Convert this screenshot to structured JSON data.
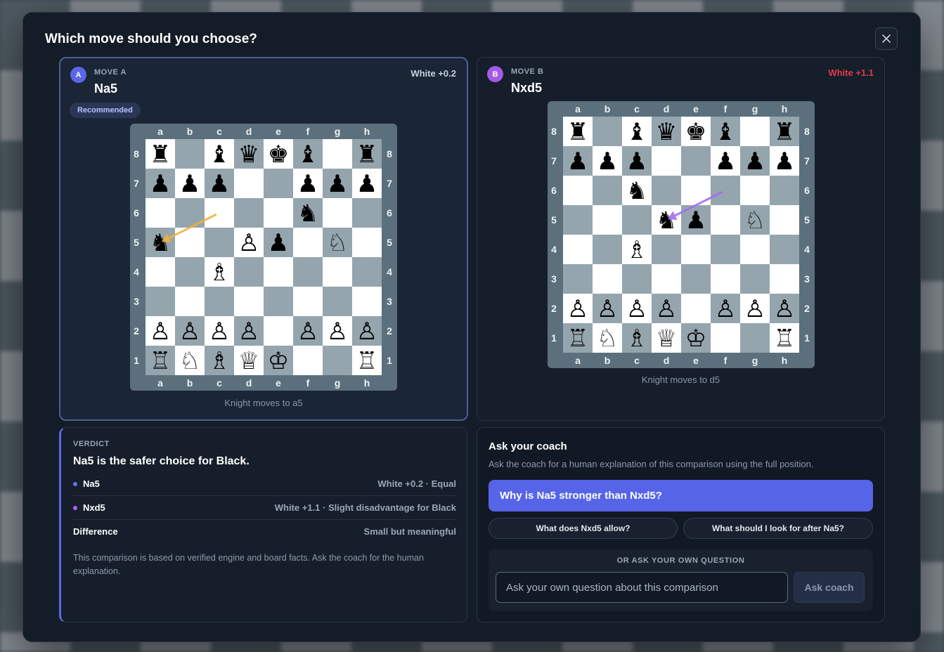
{
  "dialog": {
    "title": "Which move should you choose?",
    "close_icon": "close-icon"
  },
  "move_a": {
    "badge": "A",
    "label": "MOVE A",
    "san": "Na5",
    "eval": "White +0.2",
    "eval_color": "#c9d1db",
    "badge_color": "#5b67e6",
    "tag": "Recommended",
    "caption": "Knight moves to a5",
    "arrow_color": "#f0b23a",
    "arrow_from": "c6",
    "arrow_to": "a5",
    "position": [
      [
        "r",
        "",
        "b",
        "q",
        "k",
        "b",
        "",
        "r"
      ],
      [
        "p",
        "p",
        "p",
        "",
        "",
        "p",
        "p",
        "p"
      ],
      [
        "",
        "",
        "",
        "",
        "",
        "n",
        "",
        ""
      ],
      [
        "n",
        "",
        "",
        "P",
        "p",
        "",
        "N",
        ""
      ],
      [
        "",
        "",
        "B",
        "",
        "",
        "",
        "",
        ""
      ],
      [
        "",
        "",
        "",
        "",
        "",
        "",
        "",
        ""
      ],
      [
        "P",
        "P",
        "P",
        "P",
        "",
        "P",
        "P",
        "P"
      ],
      [
        "R",
        "N",
        "B",
        "Q",
        "K",
        "",
        "",
        "R"
      ]
    ]
  },
  "move_b": {
    "badge": "B",
    "label": "MOVE B",
    "san": "Nxd5",
    "eval": "White +1.1",
    "eval_color": "#e23a4a",
    "badge_color": "#a35be6",
    "caption": "Knight moves to d5",
    "arrow_color": "#a46cf0",
    "arrow_from": "f6",
    "arrow_to": "d5",
    "position": [
      [
        "r",
        "",
        "b",
        "q",
        "k",
        "b",
        "",
        "r"
      ],
      [
        "p",
        "p",
        "p",
        "",
        "",
        "p",
        "p",
        "p"
      ],
      [
        "",
        "",
        "n",
        "",
        "",
        "",
        "",
        ""
      ],
      [
        "",
        "",
        "",
        "n",
        "p",
        "",
        "N",
        ""
      ],
      [
        "",
        "",
        "B",
        "",
        "",
        "",
        "",
        ""
      ],
      [
        "",
        "",
        "",
        "",
        "",
        "",
        "",
        ""
      ],
      [
        "P",
        "P",
        "P",
        "P",
        "",
        "P",
        "P",
        "P"
      ],
      [
        "R",
        "N",
        "B",
        "Q",
        "K",
        "",
        "",
        "R"
      ]
    ]
  },
  "board": {
    "files": [
      "a",
      "b",
      "c",
      "d",
      "e",
      "f",
      "g",
      "h"
    ],
    "ranks": [
      "8",
      "7",
      "6",
      "5",
      "4",
      "3",
      "2",
      "1"
    ],
    "light_color": "#ffffff",
    "dark_color": "#95a5ae",
    "frame_color": "#5b707c"
  },
  "verdict": {
    "label": "VERDICT",
    "title": "Na5 is the safer choice for Black.",
    "rows": [
      {
        "name": "Na5",
        "dot_color": "#6471ee",
        "value": "White +0.2 · Equal"
      },
      {
        "name": "Nxd5",
        "dot_color": "#b260ee",
        "value": "White +1.1 · Slight disadvantage for Black"
      }
    ],
    "difference_label": "Difference",
    "difference_value": "Small but meaningful",
    "note": "This comparison is based on verified engine and board facts. Ask the coach for the human explanation."
  },
  "coach": {
    "title": "Ask your coach",
    "subtitle": "Ask the coach for a human explanation of this comparison using the full position.",
    "primary_question": "Why is Na5 stronger than Nxd5?",
    "chips": [
      "What does Nxd5 allow?",
      "What should I look for after Na5?"
    ],
    "own_label": "OR ASK YOUR OWN QUESTION",
    "input_placeholder": "Ask your own question about this comparison",
    "ask_button": "Ask coach"
  }
}
